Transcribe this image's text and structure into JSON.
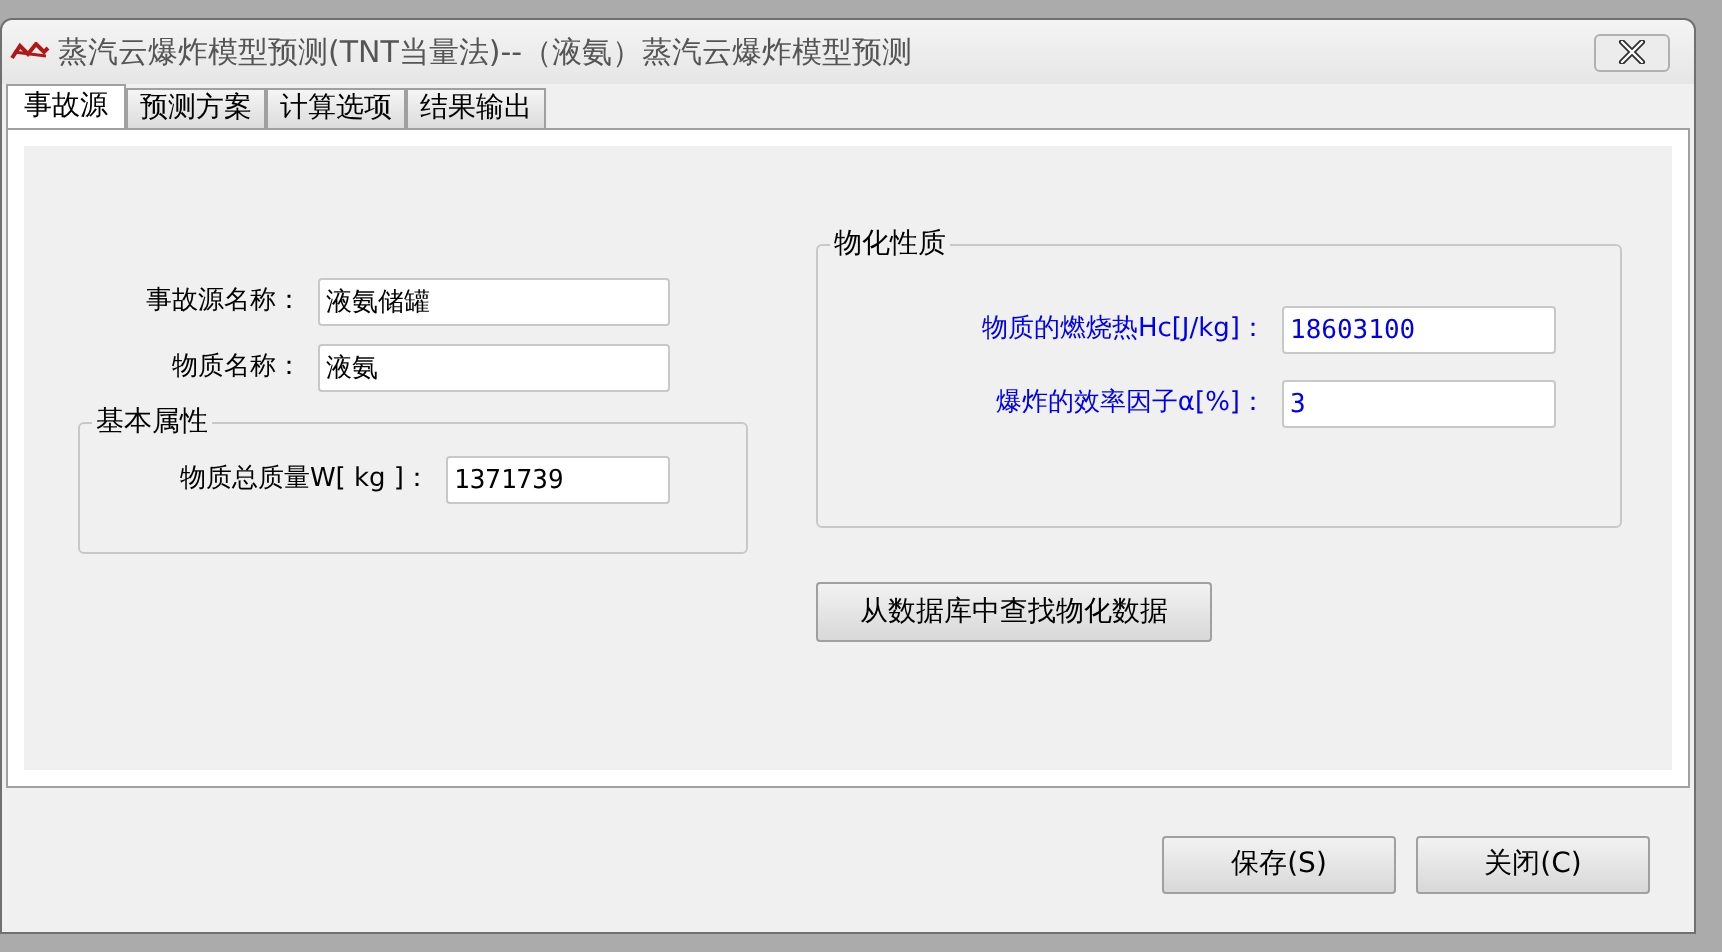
{
  "window": {
    "title": "蒸汽云爆炸模型预测(TNT当量法)--（液氨）蒸汽云爆炸模型预测"
  },
  "tabs": [
    {
      "label": "事故源",
      "selected": true
    },
    {
      "label": "预测方案",
      "selected": false
    },
    {
      "label": "计算选项",
      "selected": false
    },
    {
      "label": "结果输出",
      "selected": false
    }
  ],
  "source_fields": [
    {
      "label": "事故源名称：",
      "value": "液氨储罐"
    },
    {
      "label": "物质名称：",
      "value": "液氨"
    }
  ],
  "basic_properties": {
    "title": "基本属性",
    "fields": [
      {
        "label": "物质总质量W[ kg ]：",
        "value": "1371739"
      }
    ]
  },
  "physicochemical": {
    "title": "物化性质",
    "fields": [
      {
        "label": "物质的燃烧热Hc[J/kg]：",
        "value": "18603100"
      },
      {
        "label": "爆炸的效率因子α[%]：",
        "value": "3"
      }
    ]
  },
  "lookup_button": "从数据库中查找物化数据",
  "buttons": [
    "保存(S)",
    "关闭(C)"
  ]
}
